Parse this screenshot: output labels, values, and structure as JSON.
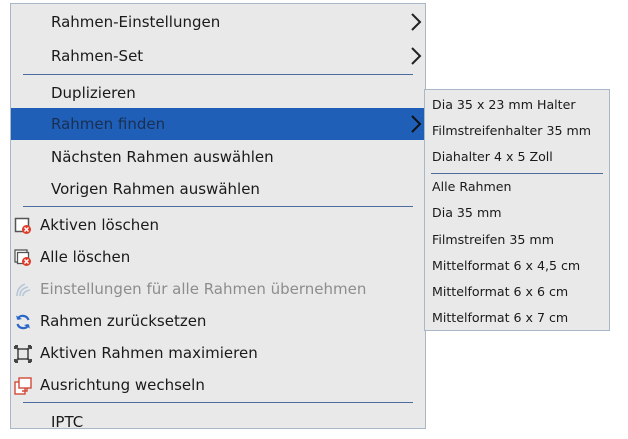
{
  "colors": {
    "menu_bg": "#e9e9e9",
    "highlight": "#1f5fb8",
    "separator": "#4c6d9e",
    "disabled_text": "#8d8d8d"
  },
  "menu": {
    "items": [
      {
        "label": "Rahmen-Einstellungen",
        "submenu": true
      },
      {
        "label": "Rahmen-Set",
        "submenu": true
      },
      {
        "label": "Duplizieren"
      },
      {
        "label": "Rahmen finden",
        "submenu": true,
        "highlighted": true
      },
      {
        "label": "Nächsten Rahmen auswählen"
      },
      {
        "label": "Vorigen Rahmen auswählen"
      },
      {
        "label": "Aktiven löschen",
        "icon": "delete-frame-icon"
      },
      {
        "label": "Alle löschen",
        "icon": "delete-all-frames-icon"
      },
      {
        "label": "Einstellungen für alle Rahmen übernehmen",
        "icon": "apply-all-icon",
        "disabled": true
      },
      {
        "label": "Rahmen zurücksetzen",
        "icon": "reset-icon"
      },
      {
        "label": "Aktiven Rahmen maximieren",
        "icon": "maximize-icon"
      },
      {
        "label": "Ausrichtung wechseln",
        "icon": "rotate-orientation-icon"
      },
      {
        "label": "IPTC"
      }
    ]
  },
  "submenu": {
    "items": [
      "Dia 35 x 23 mm Halter",
      "Filmstreifenhalter 35 mm",
      "Diahalter 4 x 5 Zoll",
      "Alle Rahmen",
      "Dia 35 mm",
      "Filmstreifen 35 mm",
      "Mittelformat 6 x 4,5 cm",
      "Mittelformat 6 x 6 cm",
      "Mittelformat 6 x 7 cm"
    ]
  }
}
